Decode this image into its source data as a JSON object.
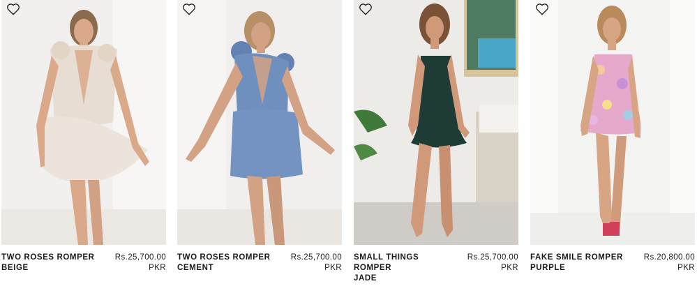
{
  "products": [
    {
      "name_line1": "TWO ROSES ROMPER",
      "name_line2": "BEIGE",
      "price": "Rs.25,700.00",
      "currency": "PKR",
      "wishlist_icon": "heart-outline-icon",
      "image_alt": "Model wearing beige romper with rose shoulders",
      "accent": "#e7ddd2"
    },
    {
      "name_line1": "TWO ROSES ROMPER",
      "name_line2": "CEMENT",
      "price": "Rs.25,700.00",
      "currency": "PKR",
      "wishlist_icon": "heart-outline-icon",
      "image_alt": "Model wearing cement blue romper with rose shoulders",
      "accent": "#6f8fbf"
    },
    {
      "name_line1": "SMALL THINGS ROMPER",
      "name_line2": "JADE",
      "price": "Rs.25,700.00",
      "currency": "PKR",
      "wishlist_icon": "heart-outline-icon",
      "image_alt": "Model wearing jade green romper",
      "accent": "#1f3b35"
    },
    {
      "name_line1": "FAKE SMILE ROMPER",
      "name_line2": "PURPLE",
      "price": "Rs.20,800.00",
      "currency": "PKR",
      "wishlist_icon": "heart-outline-icon",
      "image_alt": "Model wearing floral purple romper",
      "accent": "#e6a9cc"
    }
  ]
}
